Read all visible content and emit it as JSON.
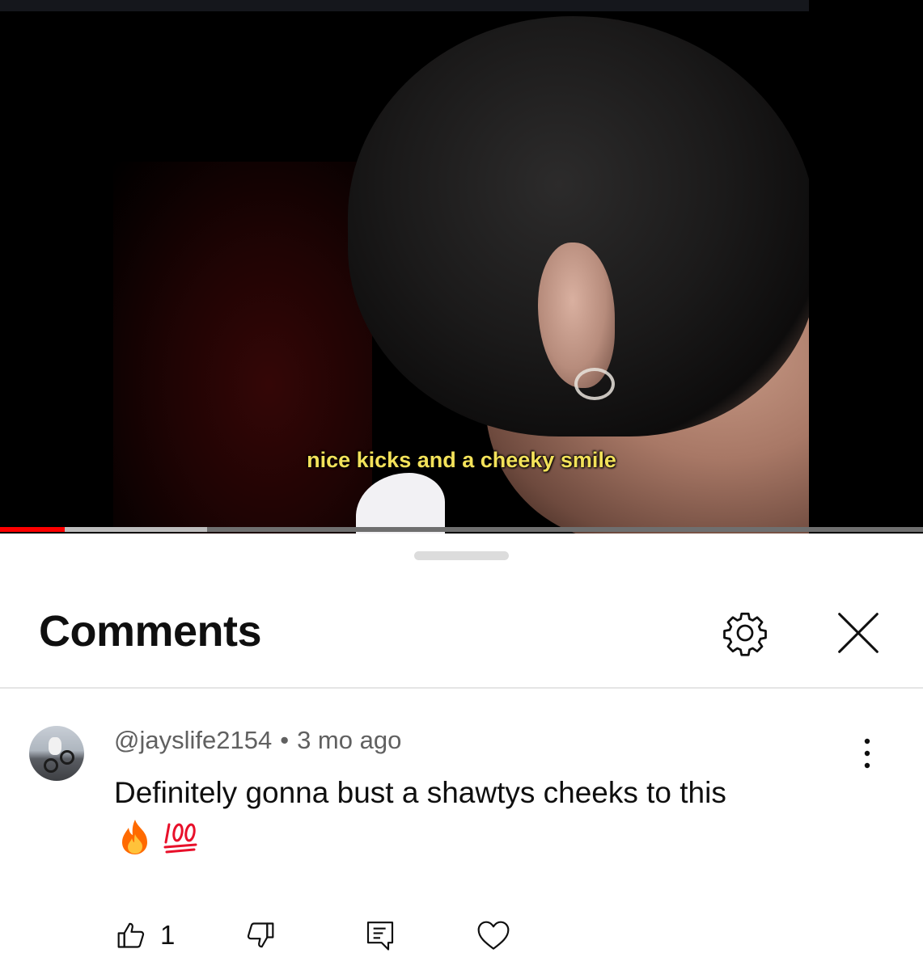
{
  "video": {
    "subtitle": "nice kicks and a cheeky smile",
    "progress": {
      "played_fraction": 0.07,
      "buffered_fraction": 0.224
    }
  },
  "comments_panel": {
    "title": "Comments",
    "settings_icon": "gear-icon",
    "close_icon": "close-icon"
  },
  "comment": {
    "author": "@jayslife2154",
    "separator": "•",
    "time": "3 mo ago",
    "text": "Definitely gonna bust a shawtys cheeks to this",
    "emojis": [
      "fire-emoji",
      "hundred-points-emoji"
    ],
    "more_icon": "more-vertical-icon",
    "actions": {
      "like_count": "1",
      "like_icon": "thumbs-up-icon",
      "dislike_icon": "thumbs-down-icon",
      "reply_icon": "reply-comment-icon",
      "heart_icon": "heart-icon"
    }
  },
  "colors": {
    "progress_played": "#ff0000",
    "subtitle": "#f3e25a",
    "meta_text": "#606060",
    "primary_text": "#0f0f0f"
  }
}
